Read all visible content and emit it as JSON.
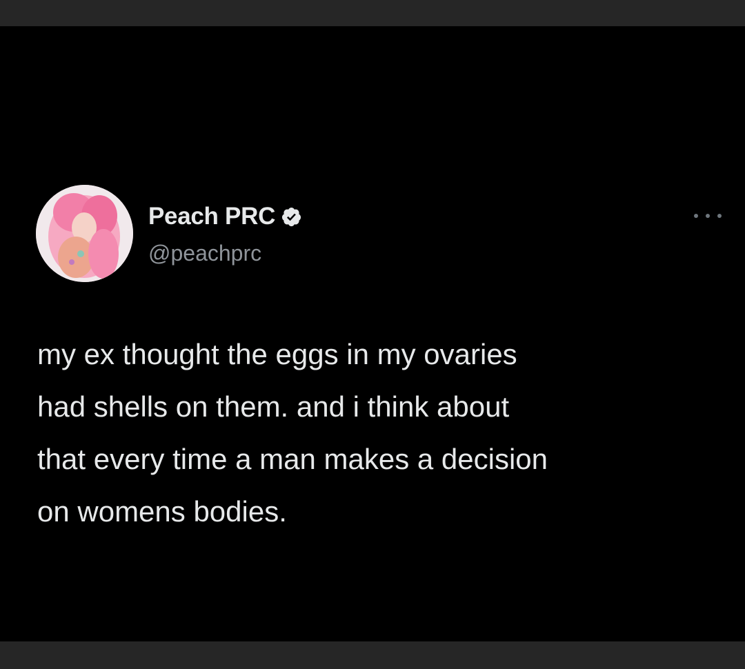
{
  "tweet": {
    "author": {
      "display_name": "Peach PRC",
      "handle": "@peachprc",
      "verified": true,
      "avatar_icon": "profile-photo-pink-hair"
    },
    "menu_icon": "more-options-icon",
    "text_lines": [
      "my ex thought the eggs in my ovaries",
      "had shells on them. and i think about",
      "that every time a man makes a decision",
      "on womens bodies."
    ]
  },
  "colors": {
    "background": "#000000",
    "frame_bars": "#262626",
    "primary_text": "#e7e9ea",
    "secondary_text": "#8f949a",
    "verified_badge": "#e7e9ea"
  }
}
